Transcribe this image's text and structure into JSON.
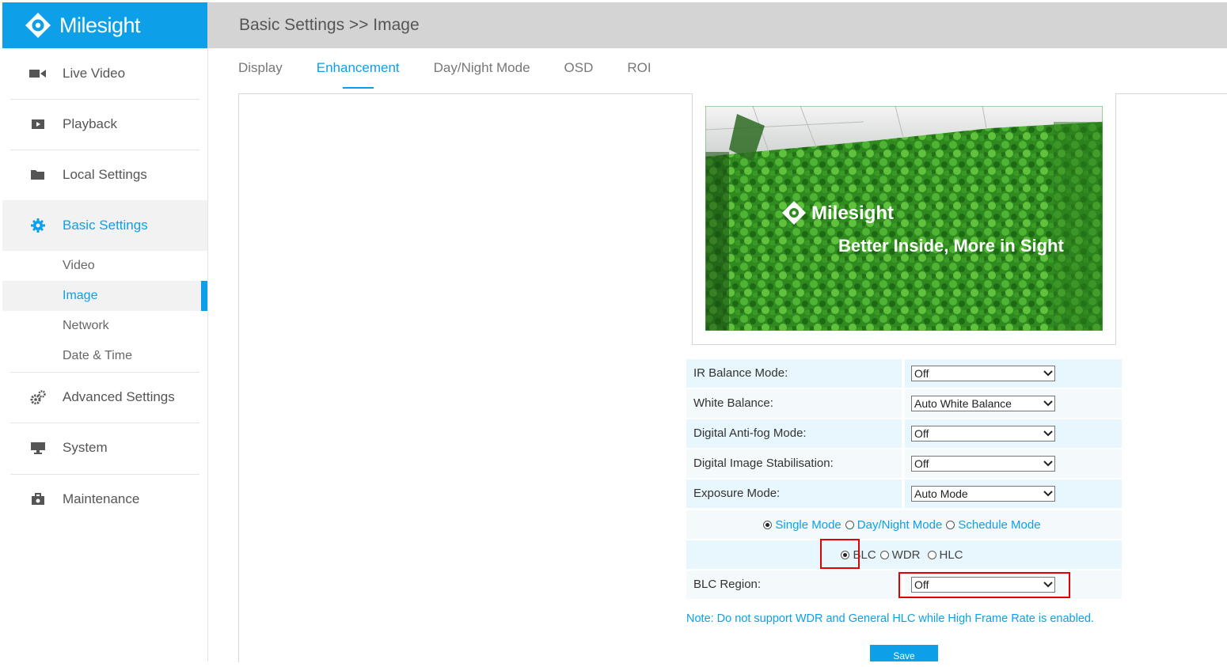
{
  "brand": {
    "name": "Milesight",
    "color": "#0da0e8"
  },
  "header": {
    "breadcrumb": "Basic Settings >> Image"
  },
  "sidebar": {
    "items": [
      {
        "label": "Live Video",
        "icon": "video-camera-icon"
      },
      {
        "label": "Playback",
        "icon": "play-icon"
      },
      {
        "label": "Local Settings",
        "icon": "folder-icon"
      },
      {
        "label": "Basic Settings",
        "icon": "gear-icon",
        "active": true
      },
      {
        "label": "Advanced Settings",
        "icon": "gears-icon"
      },
      {
        "label": "System",
        "icon": "monitor-icon"
      },
      {
        "label": "Maintenance",
        "icon": "toolbox-icon"
      }
    ],
    "sub_items": [
      {
        "label": "Video"
      },
      {
        "label": "Image",
        "active": true
      },
      {
        "label": "Network"
      },
      {
        "label": "Date & Time"
      }
    ]
  },
  "tabs": [
    {
      "label": "Display"
    },
    {
      "label": "Enhancement",
      "active": true
    },
    {
      "label": "Day/Night Mode"
    },
    {
      "label": "OSD"
    },
    {
      "label": "ROI"
    }
  ],
  "preview": {
    "logo_text": "Milesight",
    "slogan": "Better Inside, More in Sight"
  },
  "settings": {
    "ir_balance": {
      "label": "IR Balance Mode:",
      "value": "Off"
    },
    "white_balance": {
      "label": "White Balance:",
      "value": "Auto White Balance"
    },
    "anti_fog": {
      "label": "Digital Anti-fog Mode:",
      "value": "Off"
    },
    "stabilisation": {
      "label": "Digital Image Stabilisation:",
      "value": "Off"
    },
    "exposure": {
      "label": "Exposure Mode:",
      "value": "Auto Mode"
    },
    "mode_options": {
      "single": "Single Mode",
      "day_night": "Day/Night Mode",
      "schedule": "Schedule Mode",
      "selected": "Single Mode"
    },
    "compensation_options": {
      "blc": "BLC",
      "wdr": "WDR",
      "hlc": "HLC",
      "selected": "BLC"
    },
    "blc_region": {
      "label": "BLC Region:",
      "value": "Off"
    }
  },
  "note": "Note:  Do not support WDR and General HLC while High Frame Rate is enabled.",
  "save_label": "Save"
}
